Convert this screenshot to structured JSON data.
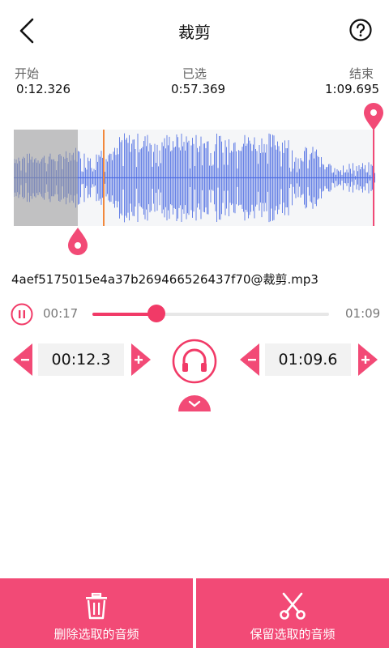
{
  "header": {
    "title": "裁剪",
    "back_icon": "chevron-left-icon",
    "help_icon": "help-circle-icon"
  },
  "range": {
    "start_label": "开始",
    "start_value": "0:12.326",
    "selected_label": "已选",
    "selected_value": "0:57.369",
    "end_label": "结束",
    "end_value": "1:09.695"
  },
  "file": {
    "name": "4aef5175015e4a37b269466526437f70@裁剪.mp3"
  },
  "playback": {
    "current": "00:17",
    "total": "01:09",
    "progress": 0.27
  },
  "start_control": {
    "value": "00:12.3"
  },
  "end_control": {
    "value": "01:09.6"
  },
  "actions": {
    "delete_label": "删除选取的音频",
    "keep_label": "保留选取的音频"
  },
  "colors": {
    "accent": "#f24a76",
    "waveform": "#4f6ee3",
    "playhead": "#f2883c"
  }
}
